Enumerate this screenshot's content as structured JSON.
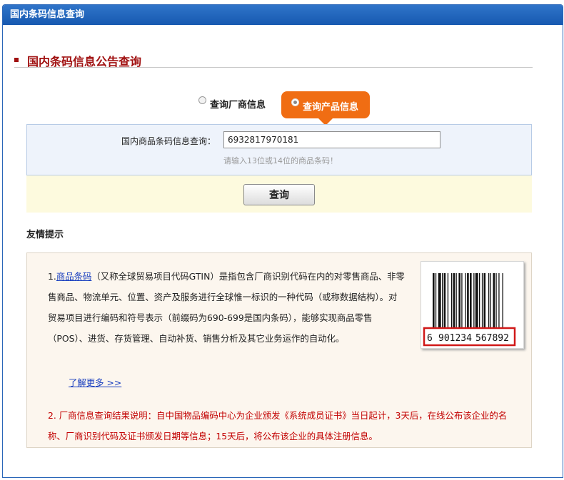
{
  "window": {
    "title": "国内条码信息查询"
  },
  "section": {
    "title": "国内条码信息公告查询"
  },
  "radios": {
    "manufacturer": {
      "label": "查询厂商信息",
      "selected": false
    },
    "product": {
      "label": "查询产品信息",
      "selected": true
    }
  },
  "query": {
    "label": "国内商品条码信息查询：",
    "value": "6932817970181",
    "hint": "请输入13位或14位的商品条码！",
    "button_label": "查询"
  },
  "tips": {
    "title": "友情提示",
    "item1": {
      "prefix": "1.",
      "link": "商品条码",
      "text": "（又称全球贸易项目代码GTIN）是指包含厂商识别代码在内的对零售商品、非零售商品、物流单元、位置、资产及服务进行全球惟一标识的一种代码（或称数据结构）。对贸易项目进行编码和符号表示（前缀码为690-699是国内条码），能够实现商品零售（POS）、进货、存货管理、自动补货、销售分析及其它业务运作的自动化。"
    },
    "more_link": "了解更多 >>",
    "item2": "2. 厂商信息查询结果说明：自中国物品编码中心为企业颁发《系统成员证书》当日起计，3天后，在线公布该企业的名称、厂商识别代码及证书颁发日期等信息；15天后，将公布该企业的具体注册信息。",
    "barcode": {
      "digits_first": "6",
      "digits_mid": "901234",
      "digits_last": "567892"
    }
  },
  "colors": {
    "title_bar": "#1759b0",
    "section_title": "#a01010",
    "orange_tab": "#f06d13",
    "tip_red": "#c20000",
    "link_blue": "#1a3fbf"
  }
}
